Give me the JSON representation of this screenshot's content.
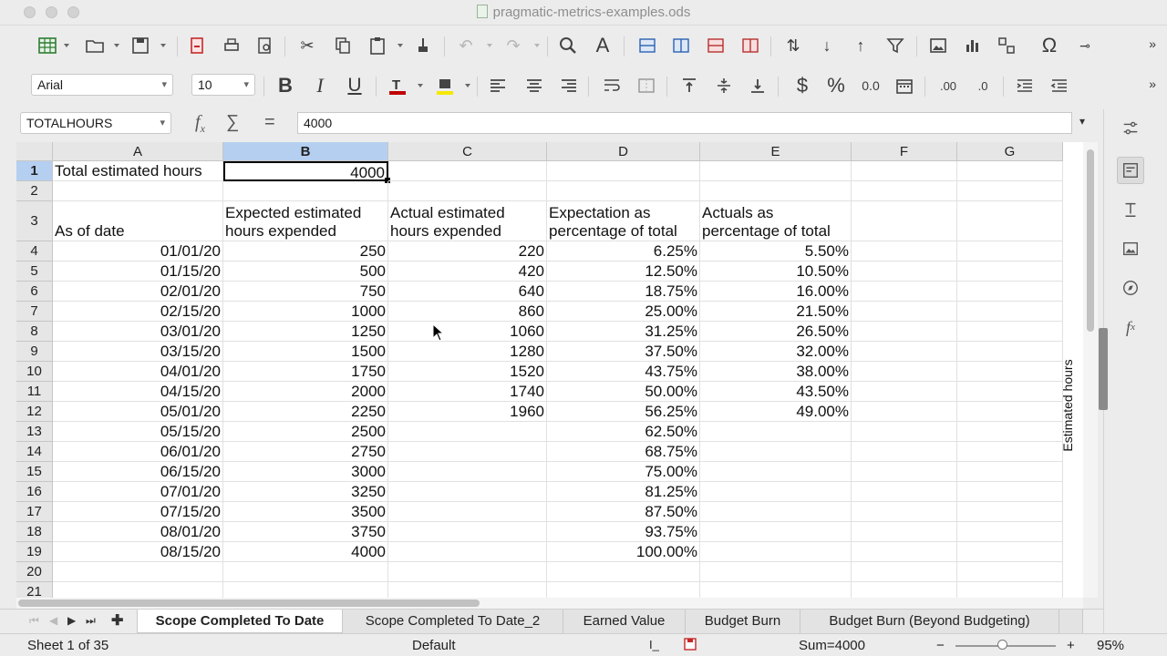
{
  "window": {
    "title": "pragmatic-metrics-examples.ods"
  },
  "formatting": {
    "font_name": "Arial",
    "font_size": "10"
  },
  "formula_bar": {
    "name_box": "TOTALHOURS",
    "content": "4000"
  },
  "columns": [
    "A",
    "B",
    "C",
    "D",
    "E",
    "F",
    "G"
  ],
  "selected_column": "B",
  "rows": [
    {
      "n": "1",
      "cells": [
        "Total estimated hours",
        "4000",
        "",
        "",
        "",
        "",
        ""
      ]
    },
    {
      "n": "2",
      "cells": [
        "",
        "",
        "",
        "",
        "",
        "",
        ""
      ]
    },
    {
      "n": "3",
      "cells": [
        "As of date",
        "Expected estimated hours expended",
        "Actual estimated hours expended",
        "Expectation as percentage of total",
        "Actuals as percentage of total",
        "",
        ""
      ]
    },
    {
      "n": "4",
      "cells": [
        "01/01/20",
        "250",
        "220",
        "6.25%",
        "5.50%",
        "",
        ""
      ]
    },
    {
      "n": "5",
      "cells": [
        "01/15/20",
        "500",
        "420",
        "12.50%",
        "10.50%",
        "",
        ""
      ]
    },
    {
      "n": "6",
      "cells": [
        "02/01/20",
        "750",
        "640",
        "18.75%",
        "16.00%",
        "",
        ""
      ]
    },
    {
      "n": "7",
      "cells": [
        "02/15/20",
        "1000",
        "860",
        "25.00%",
        "21.50%",
        "",
        ""
      ]
    },
    {
      "n": "8",
      "cells": [
        "03/01/20",
        "1250",
        "1060",
        "31.25%",
        "26.50%",
        "",
        ""
      ]
    },
    {
      "n": "9",
      "cells": [
        "03/15/20",
        "1500",
        "1280",
        "37.50%",
        "32.00%",
        "",
        ""
      ]
    },
    {
      "n": "10",
      "cells": [
        "04/01/20",
        "1750",
        "1520",
        "43.75%",
        "38.00%",
        "",
        ""
      ]
    },
    {
      "n": "11",
      "cells": [
        "04/15/20",
        "2000",
        "1740",
        "50.00%",
        "43.50%",
        "",
        ""
      ]
    },
    {
      "n": "12",
      "cells": [
        "05/01/20",
        "2250",
        "1960",
        "56.25%",
        "49.00%",
        "",
        ""
      ]
    },
    {
      "n": "13",
      "cells": [
        "05/15/20",
        "2500",
        "",
        "62.50%",
        "",
        "",
        ""
      ]
    },
    {
      "n": "14",
      "cells": [
        "06/01/20",
        "2750",
        "",
        "68.75%",
        "",
        "",
        ""
      ]
    },
    {
      "n": "15",
      "cells": [
        "06/15/20",
        "3000",
        "",
        "75.00%",
        "",
        "",
        ""
      ]
    },
    {
      "n": "16",
      "cells": [
        "07/01/20",
        "3250",
        "",
        "81.25%",
        "",
        "",
        ""
      ]
    },
    {
      "n": "17",
      "cells": [
        "07/15/20",
        "3500",
        "",
        "87.50%",
        "",
        "",
        ""
      ]
    },
    {
      "n": "18",
      "cells": [
        "08/01/20",
        "3750",
        "",
        "93.75%",
        "",
        "",
        ""
      ]
    },
    {
      "n": "19",
      "cells": [
        "08/15/20",
        "4000",
        "",
        "100.00%",
        "",
        "",
        ""
      ]
    },
    {
      "n": "20",
      "cells": [
        "",
        "",
        "",
        "",
        "",
        "",
        ""
      ]
    },
    {
      "n": "21",
      "cells": [
        "",
        "",
        "",
        "",
        "",
        "",
        ""
      ]
    }
  ],
  "chart_axis_label": "Estimated hours",
  "sheet_tabs": [
    "Scope Completed To Date",
    "Scope Completed To Date_2",
    "Earned Value",
    "Budget Burn",
    "Budget Burn (Beyond Budgeting)"
  ],
  "status": {
    "sheet": "Sheet 1 of 35",
    "style": "Default",
    "sum": "Sum=4000",
    "zoom": "95%"
  }
}
